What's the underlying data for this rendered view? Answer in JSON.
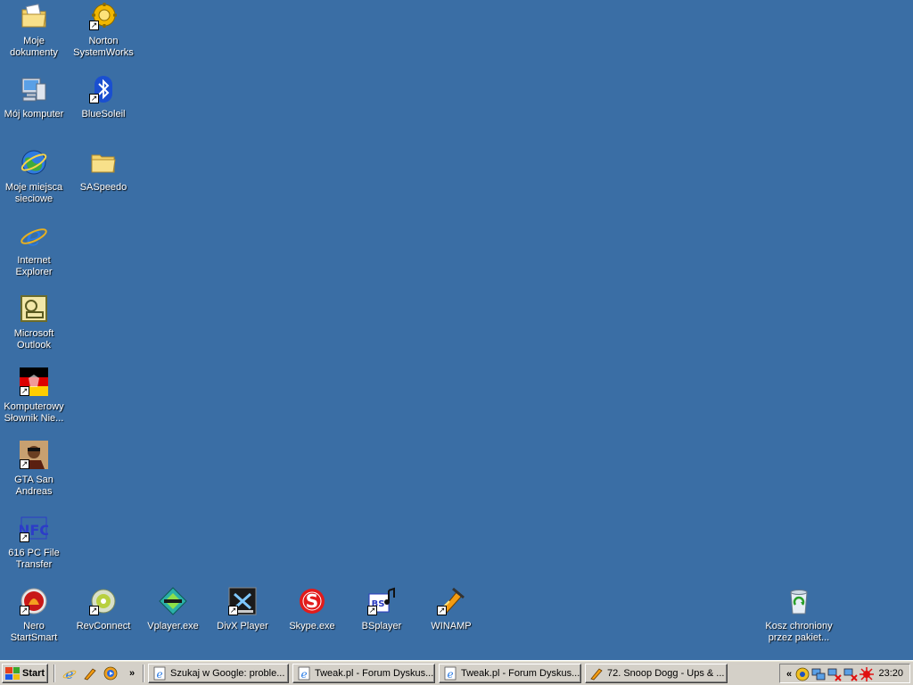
{
  "desktop": {
    "background": "#3a6ea5",
    "icons": [
      {
        "label": "Moje dokumenty",
        "icon": "my-documents-icon"
      },
      {
        "label": "Norton SystemWorks",
        "icon": "norton-systemworks-icon"
      },
      {
        "label": "Mój komputer",
        "icon": "my-computer-icon"
      },
      {
        "label": "BlueSoleil",
        "icon": "bluetooth-icon"
      },
      {
        "label": "Moje miejsca sieciowe",
        "icon": "network-places-icon"
      },
      {
        "label": "SASpeedo",
        "icon": "folder-icon"
      },
      {
        "label": "Internet Explorer",
        "icon": "internet-explorer-icon"
      },
      {
        "label": "Microsoft Outlook",
        "icon": "outlook-icon"
      },
      {
        "label": "Komputerowy Słownik Nie...",
        "icon": "dictionary-icon"
      },
      {
        "label": "GTA San Andreas",
        "icon": "gta-icon"
      },
      {
        "label": "616 PC File Transfer",
        "icon": "file-transfer-icon"
      },
      {
        "label": "Nero StartSmart",
        "icon": "nero-icon"
      },
      {
        "label": "RevConnect",
        "icon": "revconnect-icon"
      },
      {
        "label": "Vplayer.exe",
        "icon": "vplayer-icon"
      },
      {
        "label": "DivX Player",
        "icon": "divx-icon"
      },
      {
        "label": "Skype.exe",
        "icon": "skype-icon"
      },
      {
        "label": "BSplayer",
        "icon": "bsplayer-icon"
      },
      {
        "label": "WINAMP",
        "icon": "winamp-icon"
      },
      {
        "label": "Kosz chroniony przez pakiet...",
        "icon": "recycle-bin-icon"
      }
    ]
  },
  "taskbar": {
    "start_label": "Start",
    "quick_launch_more": "»",
    "tasks": [
      {
        "label": "Szukaj w Google: proble...",
        "icon": "ie-page-icon"
      },
      {
        "label": "Tweak.pl - Forum Dyskus...",
        "icon": "ie-page-icon"
      },
      {
        "label": "Tweak.pl - Forum Dyskus...",
        "icon": "ie-page-icon"
      },
      {
        "label": "72. Snoop Dogg - Ups & ...",
        "icon": "winamp-icon"
      }
    ],
    "tray": {
      "expand_label": "«",
      "clock": "23:20"
    }
  }
}
